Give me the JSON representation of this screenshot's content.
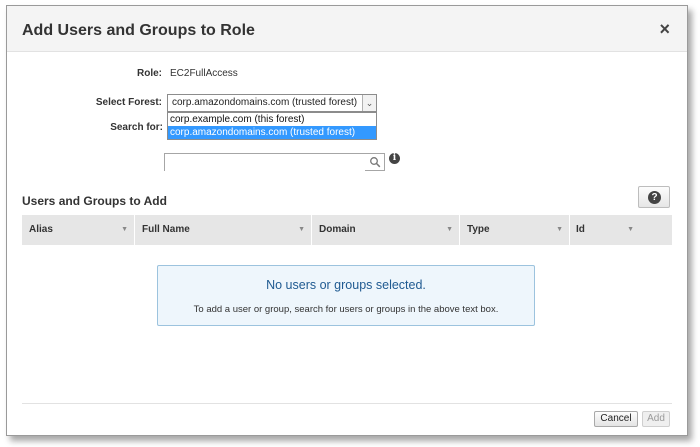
{
  "dialog": {
    "title": "Add Users and Groups to Role",
    "close_label": "×"
  },
  "form": {
    "role_label": "Role:",
    "role_value": "EC2FullAccess",
    "forest_label": "Select Forest:",
    "forest_selected": "corp.amazondomains.com (trusted forest)",
    "forest_options": [
      "corp.example.com (this forest)",
      "corp.amazondomains.com (trusted forest)"
    ],
    "search_label": "Search for:",
    "search_value": "",
    "search_placeholder": ""
  },
  "section": {
    "title": "Users and Groups to Add",
    "help_label": "?"
  },
  "table": {
    "columns": [
      "Alias",
      "Full Name",
      "Domain",
      "Type",
      "Id"
    ]
  },
  "empty_state": {
    "title": "No users or groups selected.",
    "hint": "To add a user or group, search for users or groups in the above text box."
  },
  "footer": {
    "cancel_label": "Cancel",
    "add_label": "Add"
  },
  "colors": {
    "selected_option": "#3399ff",
    "empty_box_bg": "#eef6fc",
    "empty_box_border": "#9cc3de",
    "empty_title": "#1f5a91",
    "table_header_bg": "#e6e6e6"
  }
}
